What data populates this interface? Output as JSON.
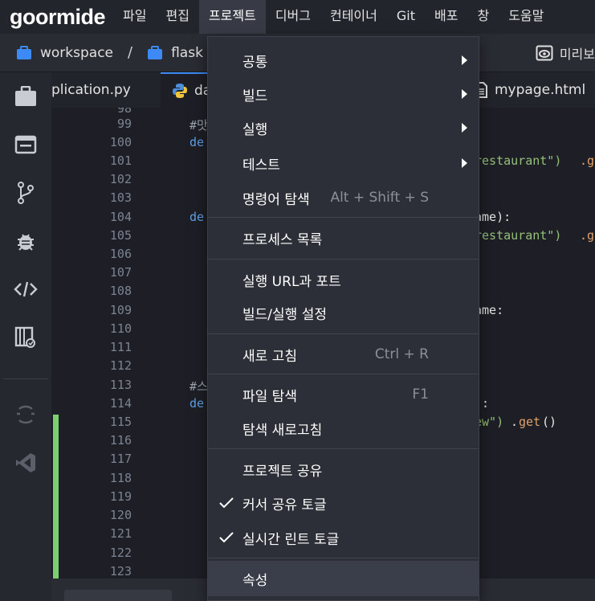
{
  "app": {
    "logo": "goormide"
  },
  "menubar": {
    "items": [
      {
        "label": "파일"
      },
      {
        "label": "편집"
      },
      {
        "label": "프로젝트",
        "active": true
      },
      {
        "label": "디버그"
      },
      {
        "label": "컨테이너"
      },
      {
        "label": "Git"
      },
      {
        "label": "배포"
      },
      {
        "label": "창"
      },
      {
        "label": "도움말"
      }
    ]
  },
  "breadcrumb": {
    "items": [
      {
        "label": "workspace",
        "icon": "briefcase-icon"
      },
      {
        "label": "flask",
        "icon": "briefcase-icon"
      }
    ],
    "separator": "/",
    "preview_label": "미리보"
  },
  "activity_bar": {
    "icons": [
      "briefcase-icon",
      "window-icon",
      "git-branch-icon",
      "bug-icon",
      "code-icon",
      "package-icon",
      "loading-icon",
      "vscode-icon"
    ]
  },
  "tabs": [
    {
      "label": "plication.py",
      "active": false
    },
    {
      "label": "da",
      "active": true,
      "icon": "python-icon"
    },
    {
      "label": "mypage.html",
      "active": false,
      "icon": "file-icon"
    }
  ],
  "editor": {
    "line_numbers": [
      "98",
      "99",
      "100",
      "101",
      "102",
      "103",
      "104",
      "105",
      "106",
      "107",
      "108",
      "109",
      "110",
      "111",
      "112",
      "113",
      "114",
      "115",
      "116",
      "117",
      "118",
      "119",
      "120",
      "121",
      "122",
      "123"
    ],
    "visible_code": {
      "l99": "#맛",
      "l100": "de",
      "l101_str": "restaurant\")",
      "l101_tail": ".g",
      "l104": "de",
      "l104_tail": "ame):",
      "l105_str": "restaurant\")",
      "l105_tail": ".g",
      "l107": ":",
      "l109": "ame:",
      "l113": "#스",
      "l114": "de",
      "l114_tail": "):",
      "l115_str": "ew\")",
      "l115_dot": ".",
      "l115_fn": "get",
      "l115_paren": "()"
    }
  },
  "dropdown": {
    "items": [
      {
        "label": "공통",
        "submenu": true
      },
      {
        "label": "빌드",
        "submenu": true
      },
      {
        "label": "실행",
        "submenu": true
      },
      {
        "label": "테스트",
        "submenu": true
      },
      {
        "label": "명령어 탐색",
        "shortcut": "Alt + Shift + S"
      },
      {
        "label": "프로세스 목록"
      },
      {
        "label": "실행 URL과 포트"
      },
      {
        "label": "빌드/실행 설정"
      },
      {
        "label": "새로 고침",
        "shortcut": "Ctrl + R"
      },
      {
        "label": "파일 탐색",
        "shortcut": "F1"
      },
      {
        "label": "탐색 새로고침"
      },
      {
        "label": "프로젝트 공유"
      },
      {
        "label": "커서 공유 토글",
        "checked": true
      },
      {
        "label": "실시간 린트 토글",
        "checked": true
      },
      {
        "label": "속성",
        "highlighted": true
      }
    ]
  },
  "colors": {
    "accent": "#3d8af7",
    "menu_bg": "#2c2f37",
    "editor_bg": "#1e1f26",
    "keyword": "#5ea0e6",
    "string": "#94c07a",
    "function": "#e2a26a",
    "diff_added": "#7dd070"
  }
}
